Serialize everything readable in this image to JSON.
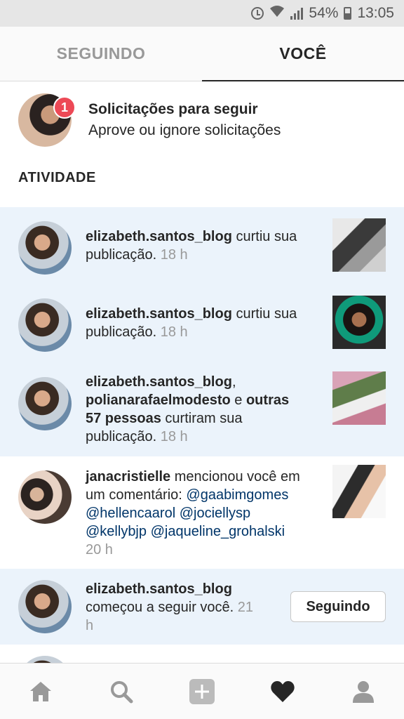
{
  "status_bar": {
    "battery": "54%",
    "time": "13:05"
  },
  "tabs": [
    {
      "label": "SEGUINDO",
      "active": false
    },
    {
      "label": "VOCÊ",
      "active": true
    }
  ],
  "requests": {
    "badge_count": "1",
    "title": "Solicitações para seguir",
    "subtitle": "Aprove ou ignore solicitações"
  },
  "section_title": "ATIVIDADE",
  "activity": [
    {
      "user": "elizabeth.santos_blog",
      "action_line1": " curtiu sua",
      "action_line2": "publicação.",
      "time": "18 h",
      "highlight": true
    },
    {
      "user": "elizabeth.santos_blog",
      "action_line1": " curtiu sua",
      "action_line2": "publicação.",
      "time": "18 h",
      "highlight": true
    },
    {
      "user1": "elizabeth.santos_blog",
      "sep1": ",",
      "user2": "polianarafaelmodesto",
      "connector": " e ",
      "others": "outras",
      "others2": "57 pessoas",
      "action": " curtiram sua",
      "action_line2": "publicação.",
      "time": "18 h",
      "highlight": true
    },
    {
      "user": "janacristielle",
      "action": " mencionou você em",
      "action_line2": "um comentário: ",
      "mentions": [
        "@gaabimgomes",
        "@hellencaarol",
        "@jociellysp",
        "@kellybjp",
        "@jaqueline_grohalski"
      ],
      "time": "20 h",
      "highlight": false
    },
    {
      "user": "elizabeth.santos_blog",
      "action_line2": "começou a seguir você.",
      "time_part1": "21",
      "time_part2": "h",
      "button_label": "Seguindo",
      "highlight": true
    }
  ],
  "colors": {
    "highlight_bg": "#ebf3fb",
    "mention": "#003569",
    "badge": "#ed4956",
    "muted": "#999999"
  },
  "bottom_nav_icons": [
    "home-icon",
    "search-icon",
    "add-icon",
    "heart-icon",
    "profile-icon"
  ]
}
